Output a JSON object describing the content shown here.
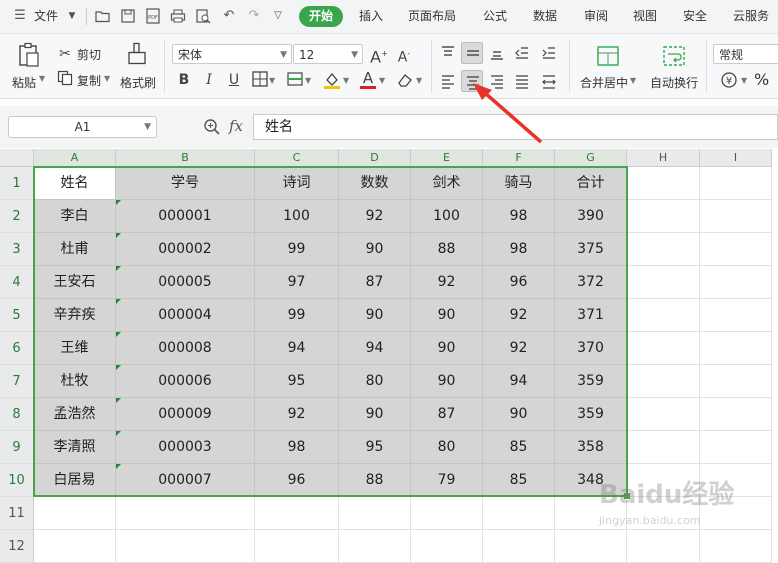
{
  "menu": {
    "file_label": "文件",
    "tabs": [
      "开始",
      "插入",
      "页面布局",
      "公式",
      "数据",
      "审阅",
      "视图",
      "安全",
      "云服务"
    ]
  },
  "ribbon": {
    "paste_label": "粘贴",
    "cut_label": "剪切",
    "copy_label": "复制",
    "format_painter_label": "格式刷",
    "font_name": "宋体",
    "font_size": "12",
    "merge_center_label": "合并居中",
    "wrap_text_label": "自动换行",
    "number_format": "常规",
    "percent_symbol": "%"
  },
  "formula_bar": {
    "cell_ref": "A1",
    "fx_label": "fx",
    "content": "姓名"
  },
  "sheet": {
    "columns": [
      "A",
      "B",
      "C",
      "D",
      "E",
      "F",
      "G",
      "H",
      "I"
    ],
    "rows": [
      "1",
      "2",
      "3",
      "4",
      "5",
      "6",
      "7",
      "8",
      "9",
      "10",
      "11",
      "12"
    ],
    "headers": [
      "姓名",
      "学号",
      "诗词",
      "数数",
      "剑术",
      "骑马",
      "合计"
    ],
    "data": [
      [
        "李白",
        "000001",
        "100",
        "92",
        "100",
        "98",
        "390"
      ],
      [
        "杜甫",
        "000002",
        "99",
        "90",
        "88",
        "98",
        "375"
      ],
      [
        "王安石",
        "000005",
        "97",
        "87",
        "92",
        "96",
        "372"
      ],
      [
        "辛弃疾",
        "000004",
        "99",
        "90",
        "90",
        "92",
        "371"
      ],
      [
        "王维",
        "000008",
        "94",
        "94",
        "90",
        "92",
        "370"
      ],
      [
        "杜牧",
        "000006",
        "95",
        "80",
        "90",
        "94",
        "359"
      ],
      [
        "孟浩然",
        "000009",
        "92",
        "90",
        "87",
        "90",
        "359"
      ],
      [
        "李清照",
        "000003",
        "98",
        "95",
        "80",
        "85",
        "358"
      ],
      [
        "白居易",
        "000007",
        "96",
        "88",
        "79",
        "85",
        "348"
      ]
    ]
  },
  "watermark": {
    "brand": "Baidu经验",
    "url": "jingyan.baidu.com"
  },
  "colors": {
    "accent": "#3aa64b",
    "selection": "#4aa34d",
    "arrow": "#e8332a"
  }
}
